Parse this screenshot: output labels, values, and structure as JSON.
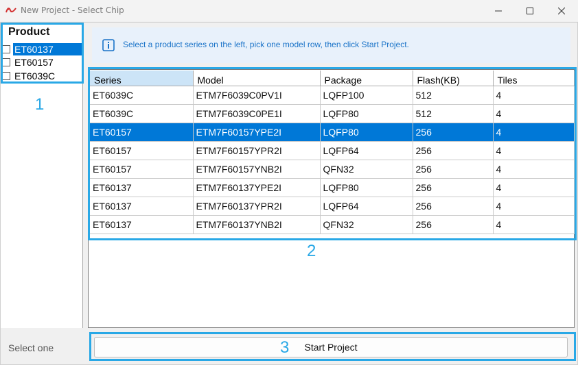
{
  "window": {
    "title": "New Project - Select Chip",
    "logo_icon": "app-logo-icon",
    "controls": [
      "minimize-icon",
      "maximize-icon",
      "close-icon"
    ]
  },
  "product_panel": {
    "header": "Product",
    "items": [
      {
        "label": "ET60137",
        "checked": false,
        "selected": true
      },
      {
        "label": "ET60157",
        "checked": false,
        "selected": false
      },
      {
        "label": "ET6039C",
        "checked": false,
        "selected": false
      }
    ],
    "status": "Select one"
  },
  "info": {
    "icon": "info-icon",
    "text": "Select a product series on the left, pick one model row, then click Start Project."
  },
  "grid": {
    "columns": [
      "Series",
      "Model",
      "Package",
      "Flash(KB)",
      "Tiles"
    ],
    "rows": [
      [
        "ET6039C",
        "ETM7F6039C0PV1I",
        "LQFP100",
        "512",
        "4"
      ],
      [
        "ET6039C",
        "ETM7F6039C0PE1I",
        "LQFP80",
        "512",
        "4"
      ],
      [
        "ET60157",
        "ETM7F60157YPE2I",
        "LQFP80",
        "256",
        "4"
      ],
      [
        "ET60157",
        "ETM7F60157YPR2I",
        "LQFP64",
        "256",
        "4"
      ],
      [
        "ET60157",
        "ETM7F60157YNB2I",
        "QFN32",
        "256",
        "4"
      ],
      [
        "ET60137",
        "ETM7F60137YPE2I",
        "LQFP80",
        "256",
        "4"
      ],
      [
        "ET60137",
        "ETM7F60137YPR2I",
        "LQFP64",
        "256",
        "4"
      ],
      [
        "ET60137",
        "ETM7F60137YNB2I",
        "QFN32",
        "256",
        "4"
      ]
    ],
    "selected_row_index": 2
  },
  "start_button": {
    "label": "Start Project"
  },
  "annotations": {
    "one": "1",
    "two": "2",
    "three": "3"
  },
  "colors": {
    "accent": "#0078d7",
    "highlight": "#29a8e6",
    "info_bg": "#e8f1fb",
    "info_text": "#1a73c8"
  }
}
